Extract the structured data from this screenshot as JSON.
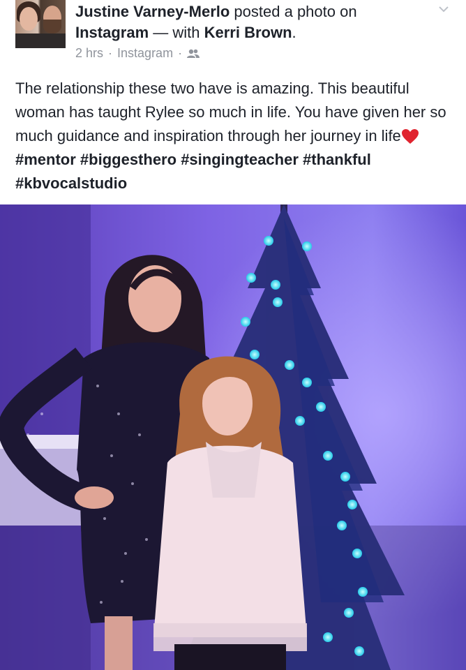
{
  "post": {
    "author": "Justine Varney-Merlo",
    "action_text": " posted a photo on ",
    "platform": "Instagram",
    "with_text": " — with ",
    "tagged": "Kerri Brown",
    "period": ".",
    "time": "2 hrs",
    "separator": "·",
    "source": "Instagram",
    "body_line1": "The relationship these two have is amazing. This beautiful woman has taught Rylee so much in life. You have given her so much guidance and inspiration through her journey in life",
    "hashtags": [
      "#mentor",
      "#biggesthero",
      "#singingteacher",
      "#thankful",
      "#kbvocalstudio"
    ]
  },
  "icons": {
    "audience": "friends-icon",
    "menu": "chevron-down-icon",
    "emoji": "red-heart-icon"
  },
  "colors": {
    "text": "#1d2129",
    "meta": "#90949c",
    "heart": "#e0242f",
    "photo_bg": "#6a4fd6"
  }
}
